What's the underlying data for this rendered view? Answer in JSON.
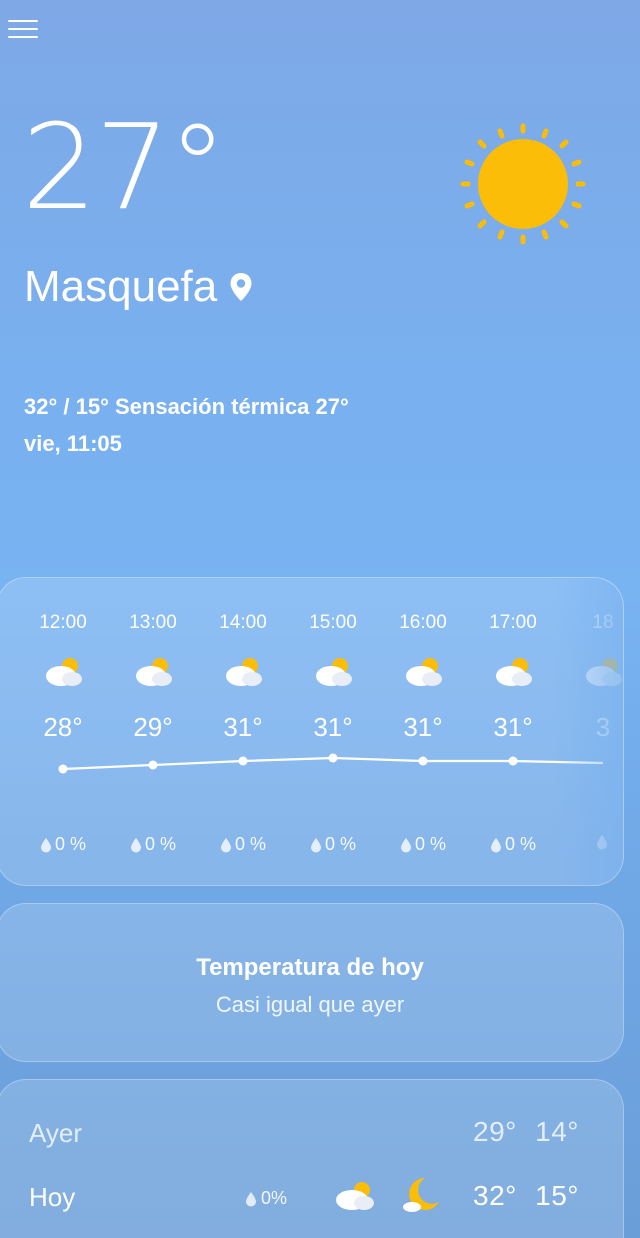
{
  "current": {
    "temperature": "27°",
    "city": "Masquefa",
    "high_low_feels": "32° / 15° Sensación térmica 27°",
    "datetime": "vie, 11:05",
    "condition_icon": "sun-icon"
  },
  "hourly": [
    {
      "time": "12:00",
      "temp": "28°",
      "rain": "0 %",
      "icon": "partly-cloudy-icon"
    },
    {
      "time": "13:00",
      "temp": "29°",
      "rain": "0 %",
      "icon": "partly-cloudy-icon"
    },
    {
      "time": "14:00",
      "temp": "31°",
      "rain": "0 %",
      "icon": "partly-cloudy-icon"
    },
    {
      "time": "15:00",
      "temp": "31°",
      "rain": "0 %",
      "icon": "partly-cloudy-icon"
    },
    {
      "time": "16:00",
      "temp": "31°",
      "rain": "0 %",
      "icon": "partly-cloudy-icon"
    },
    {
      "time": "17:00",
      "temp": "31°",
      "rain": "0 %",
      "icon": "partly-cloudy-icon"
    },
    {
      "time": "18",
      "temp": "3",
      "rain": "",
      "icon": "partly-cloudy-icon"
    }
  ],
  "today_card": {
    "title": "Temperatura de hoy",
    "subtitle": "Casi igual que ayer"
  },
  "days": [
    {
      "name": "Ayer",
      "rain": "",
      "high": "29°",
      "low": "14°"
    },
    {
      "name": "Hoy",
      "rain": "0%",
      "high": "32°",
      "low": "15°",
      "icons": [
        "partly-cloudy-icon",
        "moon-cloud-icon"
      ]
    }
  ],
  "colors": {
    "sun": "#fbbd08",
    "background_top": "#7ea8e6",
    "background_mid": "#78b3f2"
  }
}
